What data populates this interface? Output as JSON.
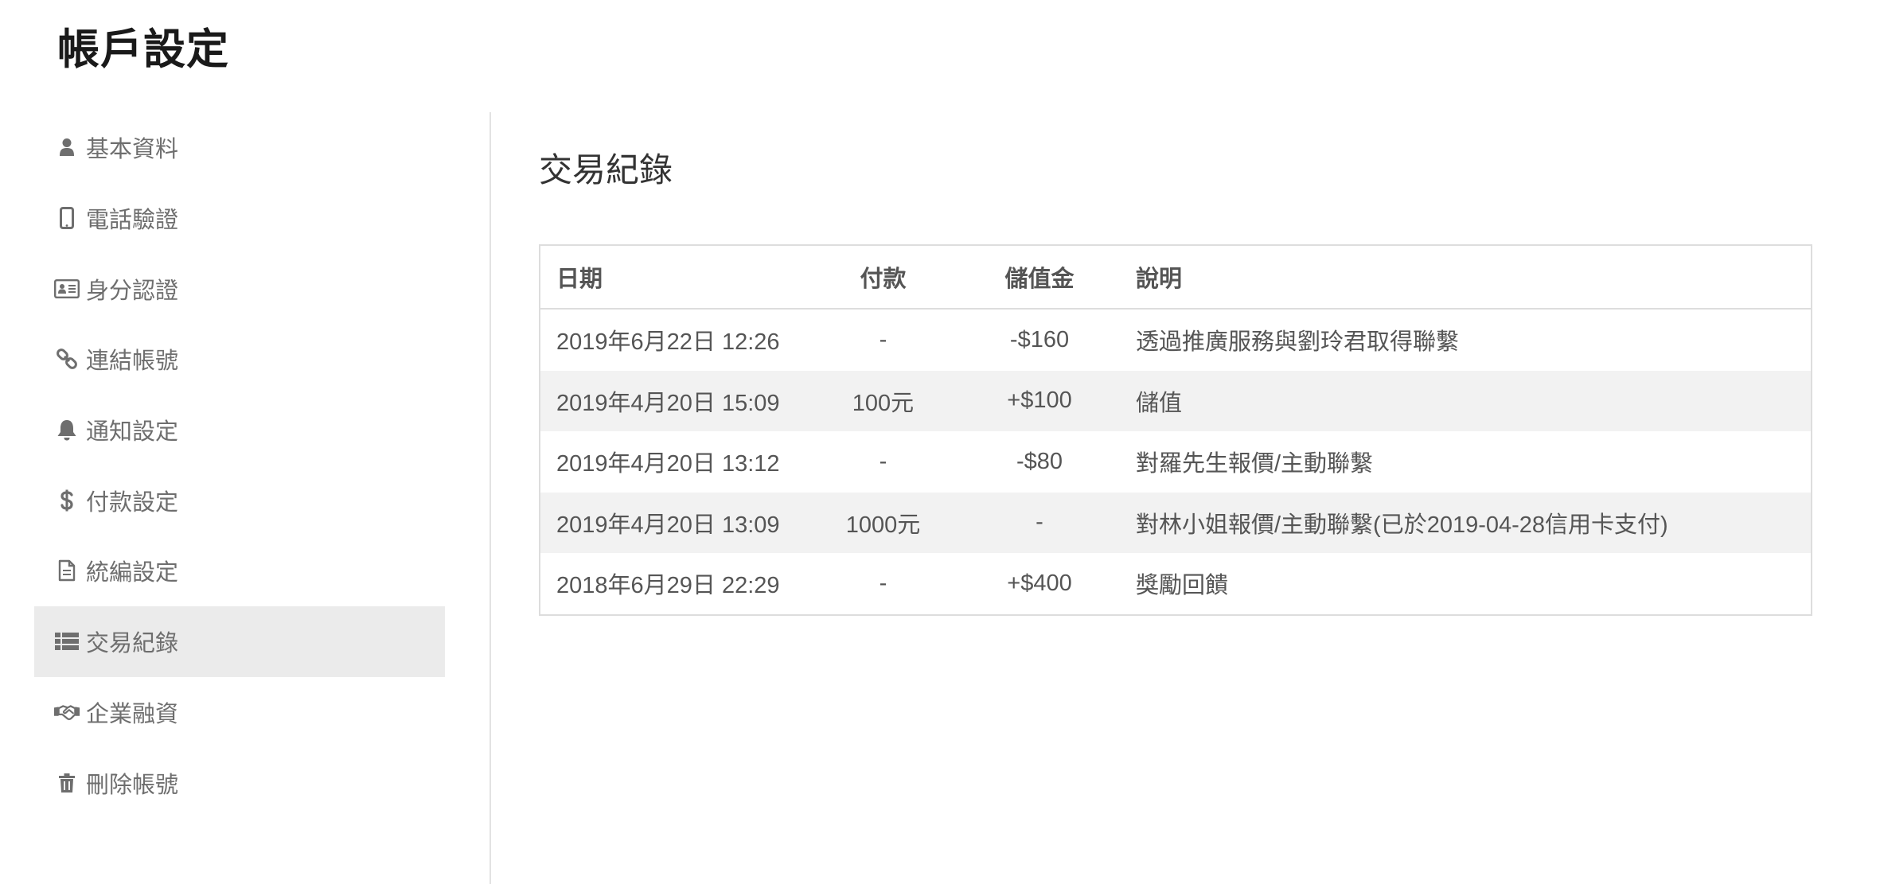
{
  "page_title": "帳戶設定",
  "sidebar": {
    "items": [
      {
        "label": "基本資料",
        "icon": "user-icon",
        "active": false
      },
      {
        "label": "電話驗證",
        "icon": "mobile-phone-icon",
        "active": false
      },
      {
        "label": "身分認證",
        "icon": "id-card-icon",
        "active": false
      },
      {
        "label": "連結帳號",
        "icon": "link-icon",
        "active": false
      },
      {
        "label": "通知設定",
        "icon": "bell-icon",
        "active": false
      },
      {
        "label": "付款設定",
        "icon": "dollar-icon",
        "active": false
      },
      {
        "label": "統編設定",
        "icon": "document-icon",
        "active": false
      },
      {
        "label": "交易紀錄",
        "icon": "list-icon",
        "active": true
      },
      {
        "label": "企業融資",
        "icon": "handshake-icon",
        "active": false
      },
      {
        "label": "刪除帳號",
        "icon": "trash-icon",
        "active": false
      }
    ]
  },
  "main": {
    "title": "交易紀錄",
    "table": {
      "headers": {
        "date": "日期",
        "payment": "付款",
        "stored_value": "儲值金",
        "description": "說明"
      },
      "rows": [
        {
          "date": "2019年6月22日 12:26",
          "payment": "-",
          "stored_value": "-$160",
          "description": "透過推廣服務與劉玲君取得聯繫"
        },
        {
          "date": "2019年4月20日 15:09",
          "payment": "100元",
          "stored_value": "+$100",
          "description": "儲值"
        },
        {
          "date": "2019年4月20日 13:12",
          "payment": "-",
          "stored_value": "-$80",
          "description": "對羅先生報價/主動聯繫"
        },
        {
          "date": "2019年4月20日 13:09",
          "payment": "1000元",
          "stored_value": "-",
          "description": "對林小姐報價/主動聯繫(已於2019-04-28信用卡支付)"
        },
        {
          "date": "2018年6月29日 22:29",
          "payment": "-",
          "stored_value": "+$400",
          "description": "獎勵回饋"
        }
      ]
    }
  },
  "colors": {
    "active_bg": "#ebebeb",
    "stripe_bg": "#f2f2f2",
    "border": "#dddddd",
    "text": "#555555",
    "icon": "#6e6e6e"
  }
}
